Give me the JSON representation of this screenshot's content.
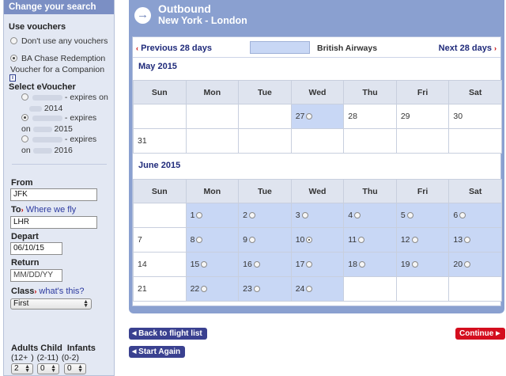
{
  "sidebar": {
    "header": "Change your search",
    "use_vouchers_title": "Use vouchers",
    "voucher_options": [
      {
        "label": "Don't use any vouchers",
        "checked": false
      },
      {
        "label": "BA Chase Redemption Voucher for a Companion",
        "checked": true
      }
    ],
    "info_icon": "i",
    "select_evoucher_title": "Select eVoucher",
    "evouchers": [
      {
        "label": "- expires on",
        "year": "2014",
        "checked": false
      },
      {
        "label": "- expires",
        "prefix": "on",
        "year": "2015",
        "checked": true
      },
      {
        "label": "- expires",
        "prefix": "on",
        "year": "2016",
        "checked": false
      }
    ],
    "from_label": "From",
    "from_value": "JFK",
    "to_label": "To",
    "where_we_fly": "Where we fly",
    "to_value": "LHR",
    "depart_label": "Depart",
    "depart_value": "06/10/15",
    "return_label": "Return",
    "return_placeholder": "MM/DD/YY",
    "class_label": "Class",
    "whats_this": "what's this?",
    "class_value": "First",
    "pax_header": {
      "adults": "Adults",
      "child": "Child",
      "infants": "Infants"
    },
    "pax_ages": {
      "adults": "(12+ )",
      "child": "(2-11)",
      "infants": "(0-2)"
    },
    "pax_values": {
      "adults": "2",
      "child": "0",
      "infants": "0"
    }
  },
  "main": {
    "title": "Outbound",
    "route": "New York - London",
    "prev_label": "Previous 28 days",
    "next_label": "Next 28 days",
    "legend_label": "British Airways",
    "weekdays": [
      "Sun",
      "Mon",
      "Tue",
      "Wed",
      "Thu",
      "Fri",
      "Sat"
    ],
    "months": [
      {
        "name": "May 2015",
        "weeks": [
          [
            {
              "d": ""
            },
            {
              "d": ""
            },
            {
              "d": ""
            },
            {
              "d": "27",
              "avail": true
            },
            {
              "d": "28"
            },
            {
              "d": "29"
            },
            {
              "d": "30"
            }
          ],
          [
            {
              "d": "31"
            },
            {
              "d": ""
            },
            {
              "d": ""
            },
            {
              "d": ""
            },
            {
              "d": ""
            },
            {
              "d": ""
            },
            {
              "d": ""
            }
          ]
        ]
      },
      {
        "name": "June 2015",
        "weeks": [
          [
            {
              "d": ""
            },
            {
              "d": "1",
              "avail": true
            },
            {
              "d": "2",
              "avail": true
            },
            {
              "d": "3",
              "avail": true
            },
            {
              "d": "4",
              "avail": true
            },
            {
              "d": "5",
              "avail": true
            },
            {
              "d": "6",
              "avail": true
            }
          ],
          [
            {
              "d": "7"
            },
            {
              "d": "8",
              "avail": true
            },
            {
              "d": "9",
              "avail": true
            },
            {
              "d": "10",
              "avail": true,
              "sel": true
            },
            {
              "d": "11",
              "avail": true
            },
            {
              "d": "12",
              "avail": true
            },
            {
              "d": "13",
              "avail": true
            }
          ],
          [
            {
              "d": "14"
            },
            {
              "d": "15",
              "avail": true
            },
            {
              "d": "16",
              "avail": true
            },
            {
              "d": "17",
              "avail": true
            },
            {
              "d": "18",
              "avail": true
            },
            {
              "d": "19",
              "avail": true
            },
            {
              "d": "20",
              "avail": true
            }
          ],
          [
            {
              "d": "21"
            },
            {
              "d": "22",
              "avail": true
            },
            {
              "d": "23",
              "avail": true
            },
            {
              "d": "24",
              "avail": true
            },
            {
              "d": ""
            },
            {
              "d": ""
            },
            {
              "d": ""
            }
          ]
        ]
      }
    ]
  },
  "buttons": {
    "back": "Back to flight list",
    "again": "Start Again",
    "continue": "Continue"
  },
  "colors": {
    "panel": "#8aa0d0",
    "available": "#c8d7f5",
    "primary_button": "#3a4190",
    "continue_button": "#d40e1e"
  }
}
